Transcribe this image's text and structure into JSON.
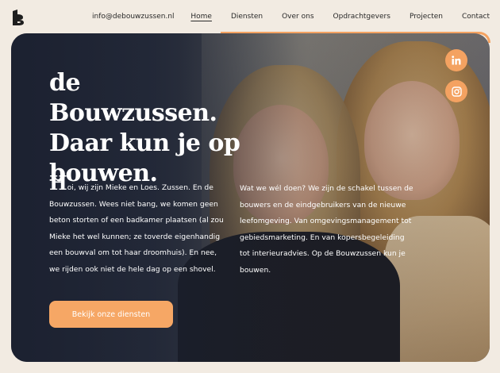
{
  "header": {
    "email": "info@debouwzussen.nl",
    "nav": [
      {
        "label": "Home",
        "active": true
      },
      {
        "label": "Diensten",
        "active": false
      },
      {
        "label": "Over ons",
        "active": false
      },
      {
        "label": "Opdrachtgevers",
        "active": false
      },
      {
        "label": "Projecten",
        "active": false
      },
      {
        "label": "Contact",
        "active": false
      }
    ]
  },
  "hero": {
    "title_line1": "de Bouwzussen.",
    "title_line2": "Daar kun je op",
    "title_line3": "bouwen.",
    "intro_dropcap": "H",
    "intro_text": "oi, wij zijn Mieke en Loes. Zussen. En de Bouwzussen. Wees niet bang, we komen geen beton storten of een badkamer plaatsen (al zou Mieke het wel kunnen; ze toverde eigenhandig een bouwval om tot haar droomhuis). En nee, we rijden ook niet de hele dag op een shovel.",
    "right_text": "Wat we wél doen? We zijn de schakel tussen de bouwers en de eindgebruikers van de nieuwe leefomgeving. Van omgevingsmanagement tot gebiedsmarketing. En van kopersbegeleiding tot interieuradvies. Op de Bouwzussen kun je bouwen.",
    "cta_label": "Bekijk onze diensten"
  },
  "social": {
    "linkedin_icon": "linkedin-icon",
    "instagram_icon": "instagram-icon"
  },
  "colors": {
    "accent": "#f4a261",
    "background": "#f2ebe2"
  }
}
